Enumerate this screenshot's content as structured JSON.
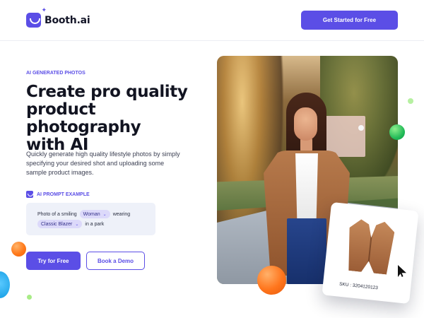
{
  "brand": {
    "name": "Booth.ai",
    "icon": "smile-logo-icon"
  },
  "header": {
    "cta_label": "Get Started for Free"
  },
  "hero": {
    "eyebrow": "AI GENERATED PHOTOS",
    "title_lines": [
      "Create pro quality",
      "product photography",
      "with AI"
    ],
    "description": "Quickly generate high quality lifestyle photos by simply specifying your desired shot and uploading some sample product images."
  },
  "prompt": {
    "label": "AI PROMPT EXAMPLE",
    "icon": "smile-prompt-icon",
    "line1_prefix": "Photo of a smiling",
    "subject_option": "Woman",
    "line1_suffix": "wearing",
    "product_option": "Classic Blazer",
    "line2_suffix": "in a park"
  },
  "actions": {
    "try_label": "Try for Free",
    "demo_label": "Book a Demo"
  },
  "product_card": {
    "sku_label": "SKU : 3204120123"
  },
  "colors": {
    "brand": "#5b4ee6",
    "accent_orange": "#ff751c",
    "accent_green": "#22ba58",
    "accent_blue": "#109be2"
  }
}
